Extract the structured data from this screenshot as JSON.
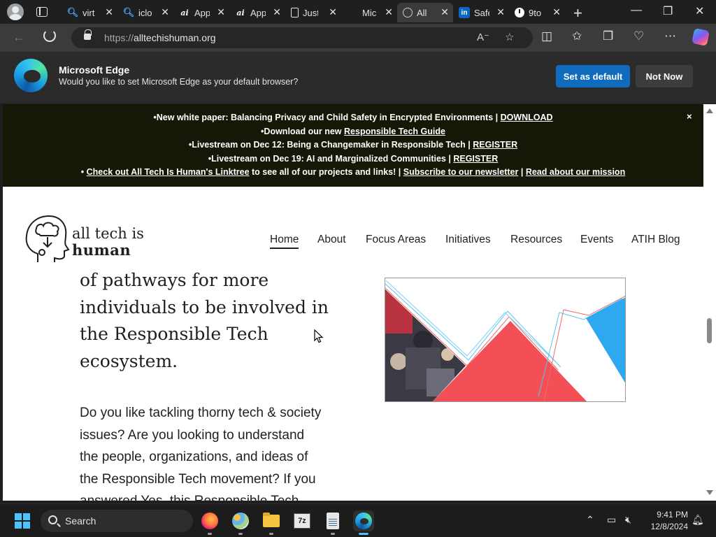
{
  "browser": {
    "tabs": [
      {
        "title": "virt",
        "icon": "search-icon",
        "active": false
      },
      {
        "title": "iclo",
        "icon": "search-icon",
        "active": false
      },
      {
        "title": "App",
        "icon": "ai-icon",
        "active": false
      },
      {
        "title": "App",
        "icon": "ai-icon",
        "active": false
      },
      {
        "title": "Just",
        "icon": "document-icon",
        "active": false
      },
      {
        "title": "Mic",
        "icon": "microsoft-icon",
        "active": false
      },
      {
        "title": "All",
        "icon": "globe-icon",
        "active": true
      },
      {
        "title": "Safe",
        "icon": "linkedin-icon",
        "active": false
      },
      {
        "title": "9to",
        "icon": "clock-icon",
        "active": false
      }
    ],
    "url_prefix": "https://",
    "url_host": "alltechishuman.org",
    "new_tab": "+",
    "close_glyph": "✕"
  },
  "infobar": {
    "title": "Microsoft Edge",
    "message": "Would you like to set Microsoft Edge as your default browser?",
    "primary_button": "Set as default",
    "secondary_button": "Not Now",
    "accent": "#0f6cbd"
  },
  "banner": {
    "close": "×",
    "line1": {
      "text": "•New white paper: Balancing Privacy and Child Safety in Encrypted Environments | ",
      "link": "DOWNLOAD"
    },
    "line2": {
      "text": "•Download our new ",
      "link": "Responsible Tech Guide"
    },
    "line3": {
      "text": "•Livestream on Dec 12: Being a Changemaker in Responsible Tech | ",
      "link": "REGISTER"
    },
    "line4": {
      "text": "•Livestream on Dec 19: AI and Marginalized Communities | ",
      "link": "REGISTER"
    },
    "line5": {
      "prefix": "• ",
      "link1": "Check out All Tech Is Human's Linktree",
      "mid1": " to see all of our projects and links! | ",
      "link2": "Subscribe to our newsletter",
      "mid2": " | ",
      "link3": "Read about our mission"
    },
    "background": "#171707"
  },
  "site": {
    "logo_line1": "all tech is",
    "logo_line2": "human",
    "nav": [
      "Home",
      "About",
      "Focus Areas",
      "Initiatives",
      "Resources",
      "Events",
      "ATIH Blog"
    ],
    "hero_lines": [
      "of pathways for more",
      "individuals to be involved in",
      "the Responsible Tech",
      "ecosystem."
    ],
    "body_lines": [
      "Do you like tackling thorny tech & society",
      "issues? Are you looking to understand",
      "the people, organizations, and ideas of",
      "the Responsible Tech movement? If you",
      "answered Yes, this Responsible Tech"
    ]
  },
  "taskbar": {
    "search_label": "Search",
    "apps": [
      "firefox-icon",
      "paint-icon",
      "file-explorer-icon",
      "7zip-icon",
      "notepad-icon",
      "edge-icon"
    ],
    "seven_zip_label": "7z",
    "time": "9:41 PM",
    "date": "12/8/2024",
    "accent": "#4cc2ff"
  }
}
